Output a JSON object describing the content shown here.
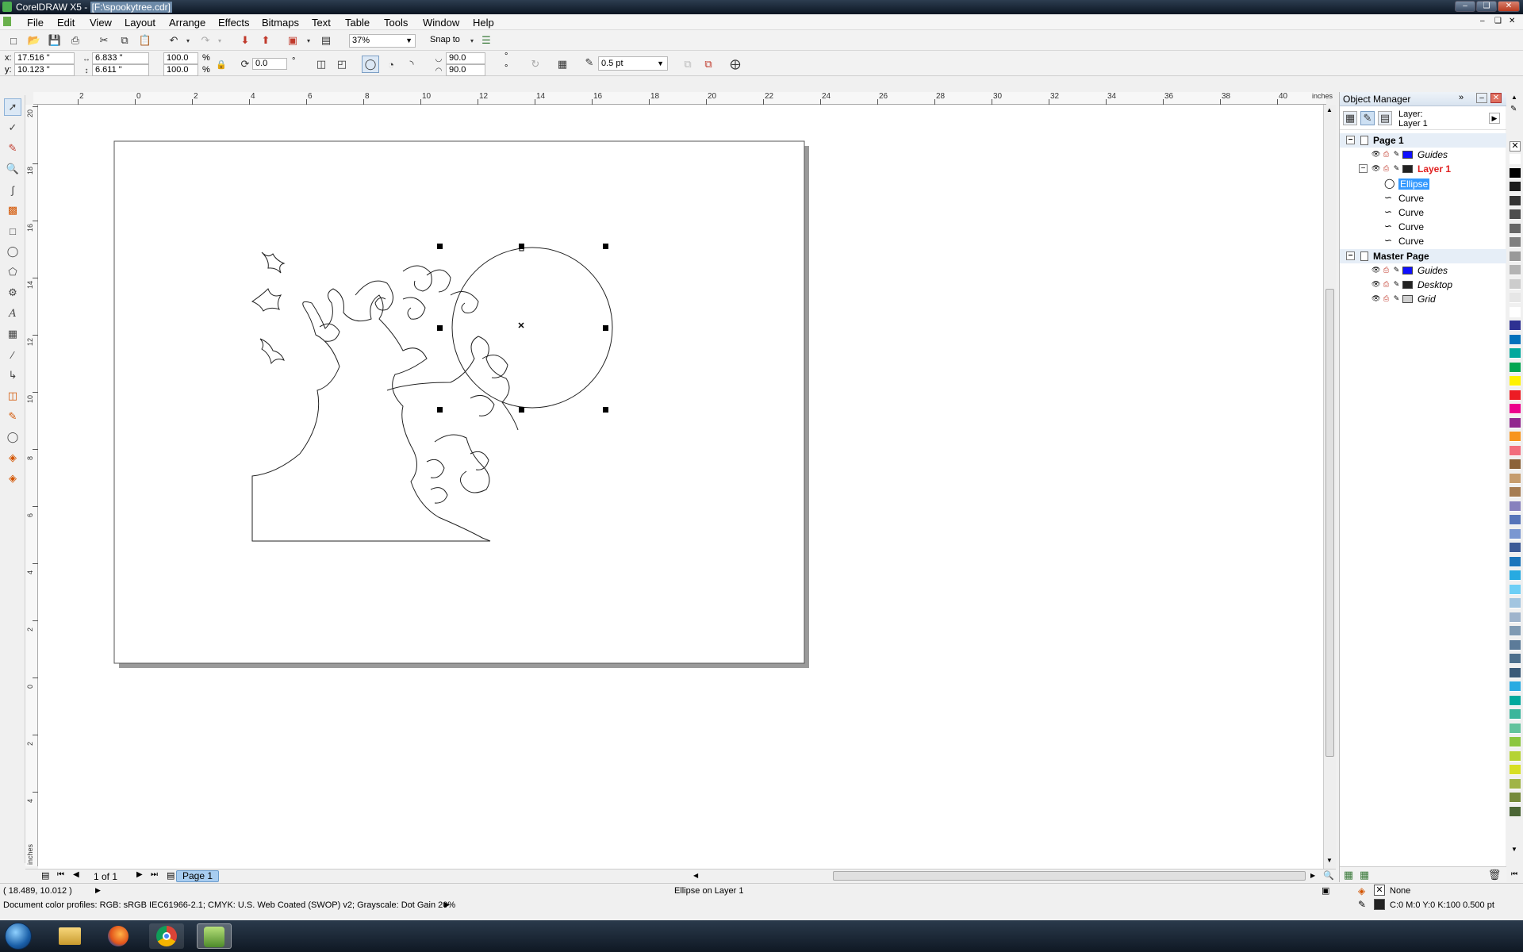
{
  "window": {
    "app_title": "CorelDRAW X5 - ",
    "file_title": "[F:\\spookytree.cdr]"
  },
  "menu": [
    "File",
    "Edit",
    "View",
    "Layout",
    "Arrange",
    "Effects",
    "Bitmaps",
    "Text",
    "Table",
    "Tools",
    "Window",
    "Help"
  ],
  "standard_toolbar": {
    "zoom_value": "37%",
    "snap_label": "Snap to"
  },
  "property_bar": {
    "x_label": "x:",
    "x_value": "17.516 \"",
    "y_label": "y:",
    "y_value": "10.123 \"",
    "width_value": "6.833 \"",
    "height_value": "6.611 \"",
    "scale_x": "100.0",
    "scale_y": "100.0",
    "percent": "%",
    "rotation_value": "0.0",
    "degree": "°",
    "start_angle": "90.0",
    "end_angle": "90.0",
    "outline_width": "0.5 pt"
  },
  "rulers": {
    "unit": "inches",
    "h_ticks": [
      "2",
      "0",
      "2",
      "4",
      "6",
      "8",
      "10",
      "12",
      "14",
      "16",
      "18",
      "20",
      "22",
      "24",
      "26",
      "28",
      "30",
      "32",
      "34",
      "36",
      "38",
      "40"
    ],
    "v_ticks": [
      "20",
      "18",
      "16",
      "14",
      "12",
      "10",
      "8",
      "6",
      "4",
      "2",
      "0",
      "2",
      "4"
    ],
    "v_unit": "inches"
  },
  "page_nav": {
    "page_count": "1 of 1",
    "page_tab": "Page 1"
  },
  "object_manager": {
    "title": "Object Manager",
    "layer_label": "Layer:",
    "layer_value": "Layer 1",
    "tree": [
      {
        "kind": "page",
        "label": "Page 1"
      },
      {
        "kind": "layer",
        "label": "Guides",
        "color": "#1010ff",
        "italic": true
      },
      {
        "kind": "layer",
        "label": "Layer 1",
        "color": "#222222",
        "active": true
      },
      {
        "kind": "object",
        "label": "Ellipse",
        "selected": true,
        "icon": "ellipse-icon"
      },
      {
        "kind": "object",
        "label": "Curve",
        "icon": "curve-icon"
      },
      {
        "kind": "object",
        "label": "Curve",
        "icon": "curve-icon"
      },
      {
        "kind": "object",
        "label": "Curve",
        "icon": "curve-icon"
      },
      {
        "kind": "object",
        "label": "Curve",
        "icon": "curve-icon"
      },
      {
        "kind": "page",
        "label": "Master Page"
      },
      {
        "kind": "layer",
        "label": "Guides",
        "color": "#1010ff",
        "italic": true
      },
      {
        "kind": "layer",
        "label": "Desktop",
        "color": "#222222",
        "italic": true
      },
      {
        "kind": "layer",
        "label": "Grid",
        "color": "#d0d0d0",
        "italic": true
      }
    ]
  },
  "status": {
    "coords": "( 18.489, 10.012 )",
    "selection": "Ellipse on Layer 1",
    "fill_label": "None",
    "outline_label": "C:0 M:0 Y:0 K:100  0.500 pt",
    "color_profiles": "Document color profiles: RGB: sRGB IEC61966-2.1; CMYK: U.S. Web Coated (SWOP) v2; Grayscale: Dot Gain 20%"
  },
  "palette": [
    "#ffffff",
    "#000000",
    "#1a1a1a",
    "#333333",
    "#4d4d4d",
    "#666666",
    "#808080",
    "#999999",
    "#b3b3b3",
    "#cccccc",
    "#e6e6e6",
    "#ffffff",
    "#2e3192",
    "#0071bc",
    "#00a99d",
    "#00a651",
    "#fff200",
    "#ed1c24",
    "#ec008c",
    "#92278f",
    "#f7941d",
    "#f26d7d",
    "#8c6239",
    "#c69c6d",
    "#a67c52",
    "#8781bd",
    "#5674b9",
    "#7a97d1",
    "#3c5a96",
    "#1b75bc",
    "#27aae1",
    "#6dcff6",
    "#a2c5e0",
    "#9fb4cc",
    "#7f9ab3",
    "#5c7b99",
    "#4d6f8c",
    "#3a5a78",
    "#29abe2",
    "#00a99d",
    "#3ab69b",
    "#62c39d",
    "#8cc63f",
    "#b5d334",
    "#d7df23",
    "#a0b446",
    "#758a3a",
    "#4b6635"
  ],
  "taskbar_apps": [
    "start-orb",
    "explorer",
    "firefox",
    "chrome",
    "coreldraw"
  ]
}
